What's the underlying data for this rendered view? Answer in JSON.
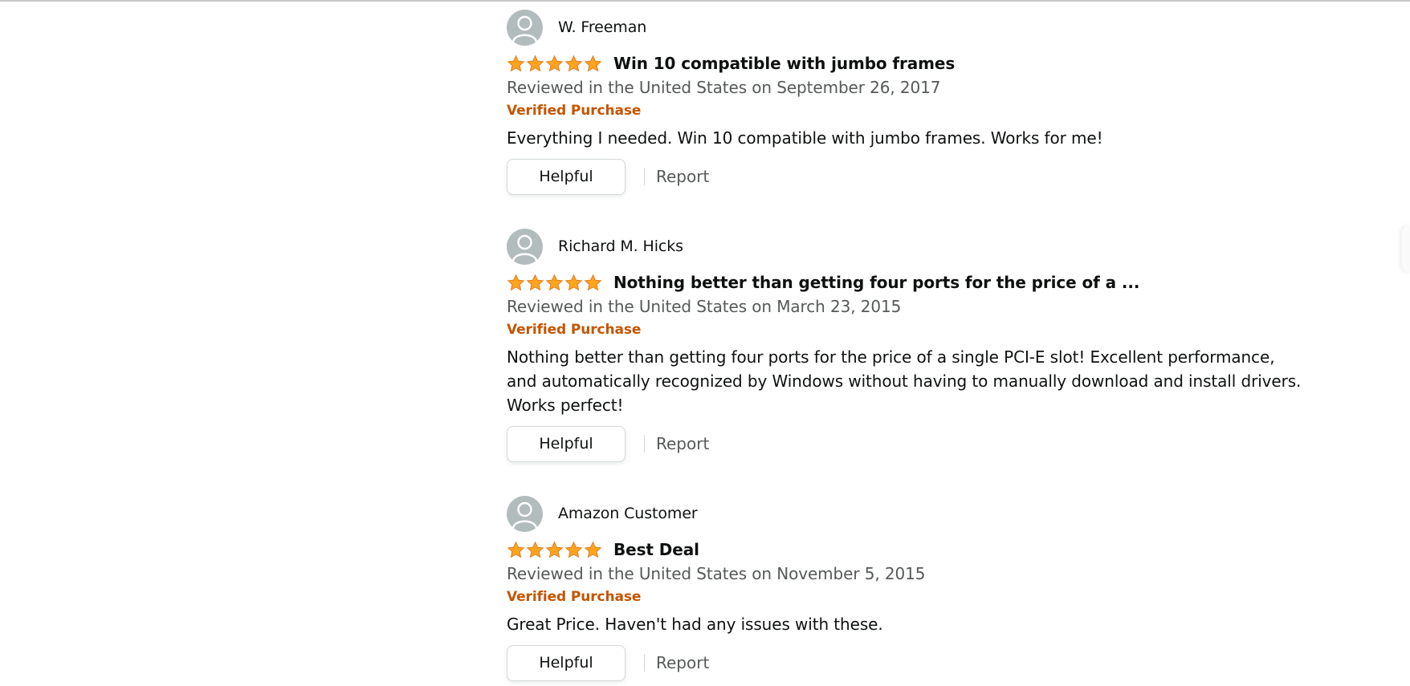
{
  "colors": {
    "star": "#ffa41c",
    "star_outline": "#de7921",
    "verified": "#c45500",
    "meta_text": "#565959",
    "avatar_bg": "#b3bcbd"
  },
  "reviews": [
    {
      "reviewer": "W. Freeman",
      "rating": 5,
      "title": "Win 10 compatible with jumbo frames",
      "date": "Reviewed in the United States on September 26, 2017",
      "verified": "Verified Purchase",
      "body": "Everything I needed. Win 10 compatible with jumbo frames. Works for me!",
      "helpful_label": "Helpful",
      "report_label": "Report"
    },
    {
      "reviewer": "Richard M. Hicks",
      "rating": 5,
      "title": "Nothing better than getting four ports for the price of a ...",
      "date": "Reviewed in the United States on March 23, 2015",
      "verified": "Verified Purchase",
      "body": "Nothing better than getting four ports for the price of a single PCI-E slot! Excellent performance, and automatically recognized by Windows without having to manually download and install drivers. Works perfect!",
      "helpful_label": "Helpful",
      "report_label": "Report"
    },
    {
      "reviewer": "Amazon Customer",
      "rating": 5,
      "title": "Best Deal",
      "date": "Reviewed in the United States on November 5, 2015",
      "verified": "Verified Purchase",
      "body": "Great Price. Haven't had any issues with these.",
      "helpful_label": "Helpful",
      "report_label": "Report"
    }
  ]
}
